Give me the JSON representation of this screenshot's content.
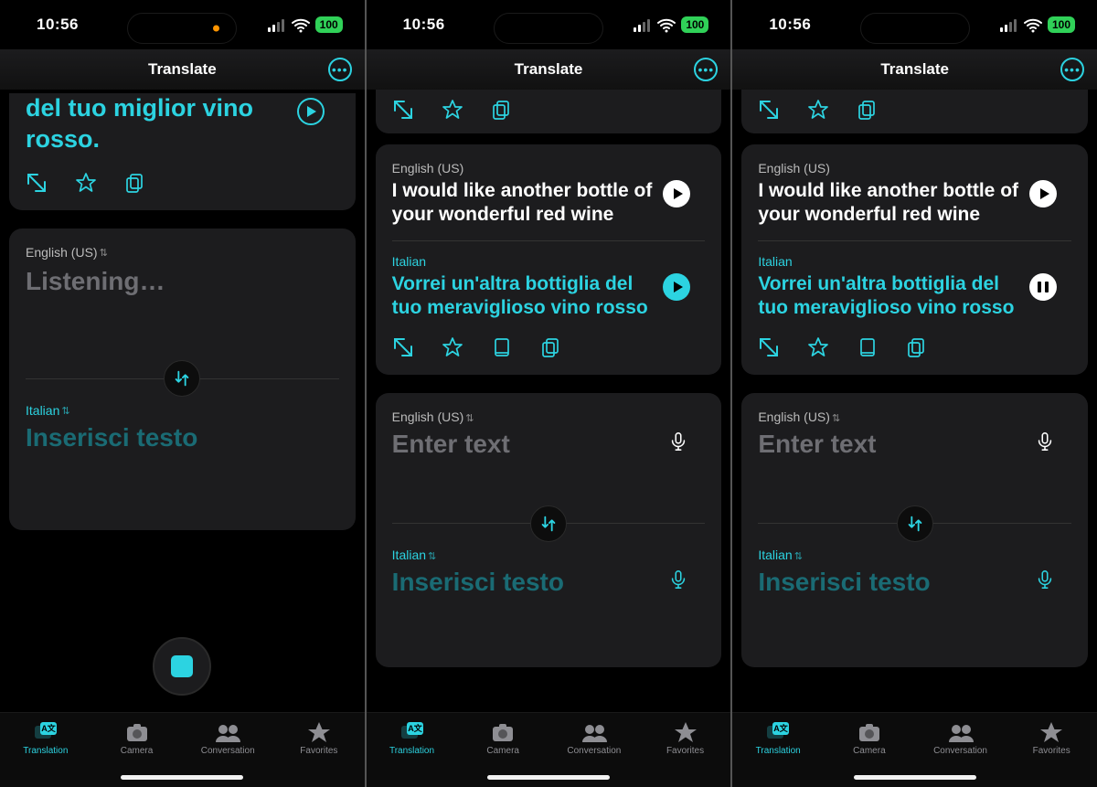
{
  "statusbar": {
    "time": "10:56",
    "battery": "100"
  },
  "navbar": {
    "title": "Translate"
  },
  "tabs": {
    "translation": "Translation",
    "camera": "Camera",
    "conversation": "Conversation",
    "favorites": "Favorites"
  },
  "shots": [
    {
      "partial_translation": "del tuo miglior vino rosso.",
      "input": {
        "src_lang": "English (US)",
        "listening": "Listening…",
        "tgt_lang": "Italian",
        "tgt_placeholder": "Inserisci testo"
      }
    },
    {
      "card": {
        "src_lang": "English (US)",
        "src_text": "I would like another bottle of your wonderful red wine",
        "tgt_lang": "Italian",
        "tgt_text": "Vorrei un'altra bottiglia del tuo meraviglioso vino rosso"
      },
      "input": {
        "src_lang": "English (US)",
        "src_placeholder": "Enter text",
        "tgt_lang": "Italian",
        "tgt_placeholder": "Inserisci testo"
      }
    },
    {
      "card": {
        "src_lang": "English (US)",
        "src_text": "I would like another bottle of your wonderful red wine",
        "tgt_lang": "Italian",
        "tgt_text": "Vorrei un'altra bottiglia del tuo meraviglioso vino rosso"
      },
      "input": {
        "src_lang": "English (US)",
        "src_placeholder": "Enter text",
        "tgt_lang": "Italian",
        "tgt_placeholder": "Inserisci testo"
      }
    }
  ]
}
